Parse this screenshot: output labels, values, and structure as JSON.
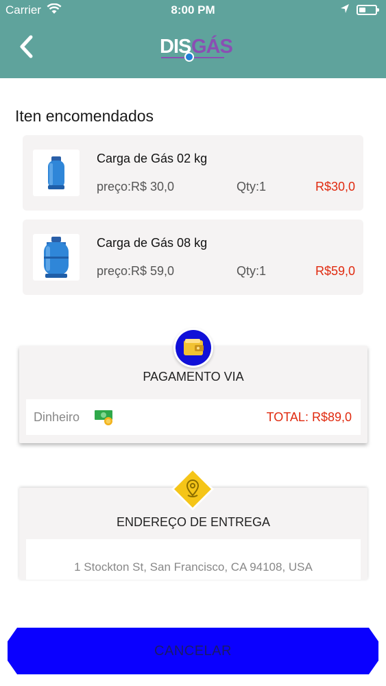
{
  "status_bar": {
    "carrier": "Carrier",
    "time": "8:00 PM"
  },
  "nav": {
    "logo_part1": "DIS",
    "logo_part2": "GÁS",
    "back_icon": "chevron-left-icon",
    "color": "#5fa39c"
  },
  "order": {
    "title": "Iten encomendados",
    "items": [
      {
        "name": "Carga de Gás 02 kg",
        "price": "preço:R$ 30,0",
        "qty": "Qty:1",
        "total": "R$30,0",
        "icon": "gas-cylinder-icon"
      },
      {
        "name": "Carga de Gás 08 kg",
        "price": "preço:R$ 59,0",
        "qty": "Qty:1",
        "total": "R$59,0",
        "icon": "gas-cylinder-icon"
      }
    ]
  },
  "payment": {
    "heading": "PAGAMENTO VIA",
    "method": "Dinheiro",
    "method_icon": "cash-icon",
    "badge_icon": "wallet-icon",
    "total": "TOTAL: R$89,0"
  },
  "delivery": {
    "heading": "ENDEREÇO DE ENTREGA",
    "badge_icon": "location-pin-icon",
    "address": "1 Stockton St, San Francisco, CA 94108, USA"
  },
  "actions": {
    "cancel_label": "CANCELAR",
    "cancel_color": "#0a00ff"
  },
  "colors": {
    "price_red": "#e02a0f",
    "badge_yellow": "#f5c518"
  }
}
